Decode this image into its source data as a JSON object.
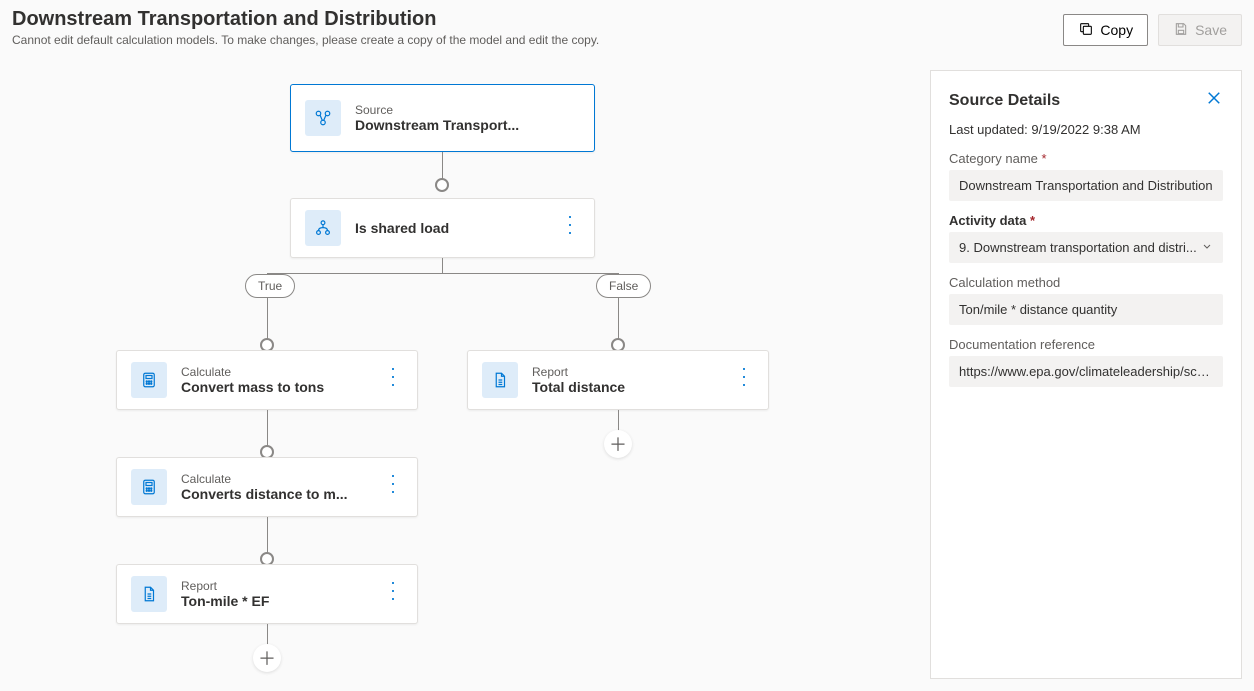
{
  "header": {
    "title": "Downstream Transportation and Distribution",
    "subtitle": "Cannot edit default calculation models. To make changes, please create a copy of the model and edit the copy.",
    "copy_label": "Copy",
    "save_label": "Save"
  },
  "nodes": {
    "source": {
      "type": "Source",
      "title": "Downstream Transport..."
    },
    "condition": {
      "title": "Is shared load"
    },
    "true_label": "True",
    "false_label": "False",
    "calc1": {
      "type": "Calculate",
      "title": "Convert mass to tons"
    },
    "calc2": {
      "type": "Calculate",
      "title": "Converts distance to m..."
    },
    "report_left": {
      "type": "Report",
      "title": "Ton-mile * EF"
    },
    "report_right": {
      "type": "Report",
      "title": "Total distance"
    }
  },
  "panel": {
    "title": "Source Details",
    "last_updated_label": "Last updated:",
    "last_updated_value": "9/19/2022 9:38 AM",
    "category_label": "Category name",
    "category_value": "Downstream Transportation and Distribution",
    "activity_label": "Activity data",
    "activity_value": "9. Downstream transportation and distri...",
    "method_label": "Calculation method",
    "method_value": "Ton/mile * distance quantity",
    "doc_label": "Documentation reference",
    "doc_value": "https://www.epa.gov/climateleadership/sco..."
  }
}
